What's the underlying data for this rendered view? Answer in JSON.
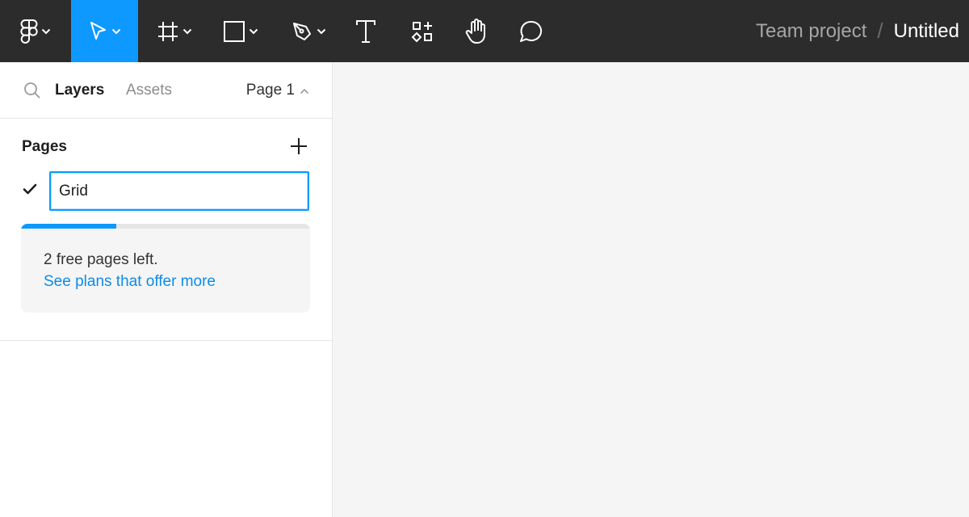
{
  "toolbar": {
    "tools": [
      {
        "name": "main-menu",
        "icon": "figma-logo-icon",
        "has_caret": true
      },
      {
        "name": "move-tool",
        "icon": "cursor-arrow-icon",
        "has_caret": true,
        "active": true
      },
      {
        "name": "frame-tool",
        "icon": "frame-hash-icon",
        "has_caret": true
      },
      {
        "name": "shape-tool",
        "icon": "rectangle-icon",
        "has_caret": true
      },
      {
        "name": "pen-tool",
        "icon": "pen-nib-icon",
        "has_caret": true
      },
      {
        "name": "text-tool",
        "icon": "text-t-icon",
        "has_caret": false
      },
      {
        "name": "resources-tool",
        "icon": "resources-icon",
        "has_caret": false
      },
      {
        "name": "hand-tool",
        "icon": "hand-icon",
        "has_caret": false
      },
      {
        "name": "comment-tool",
        "icon": "comment-bubble-icon",
        "has_caret": false
      }
    ],
    "breadcrumb": {
      "project": "Team project",
      "separator": "/",
      "file": "Untitled"
    },
    "colors": {
      "background": "#2c2c2c",
      "active": "#0d99ff"
    }
  },
  "panel": {
    "tabs": {
      "layers": "Layers",
      "assets": "Assets"
    },
    "page_selector": "Page 1",
    "pages": {
      "heading": "Pages",
      "current_page_value": "Grid",
      "usage_progress": 0.33,
      "limit_text": "2 free pages left.",
      "limit_link": "See plans that offer more"
    }
  }
}
